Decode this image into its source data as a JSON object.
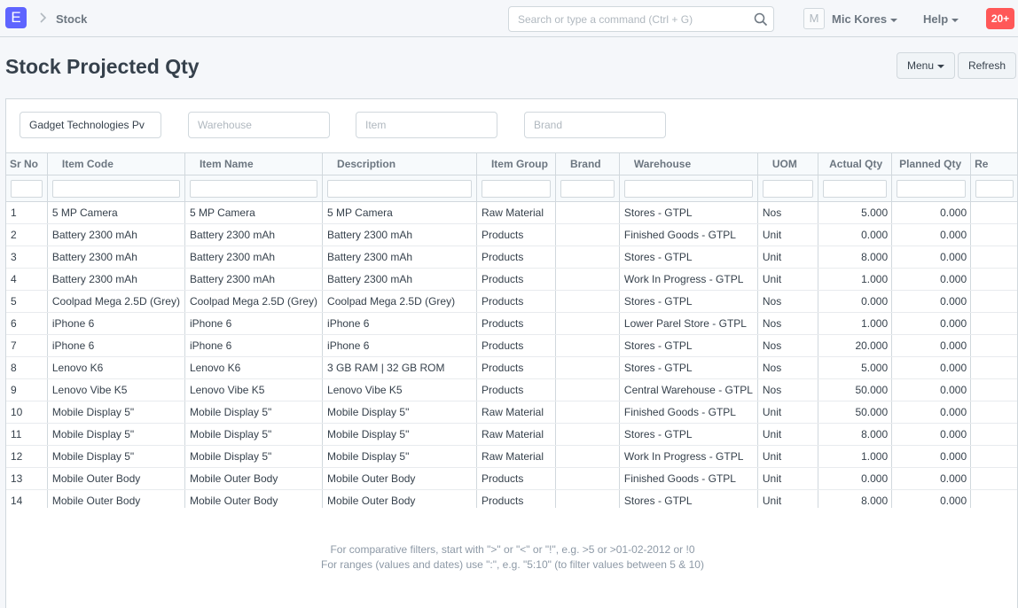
{
  "navbar": {
    "logo": "E",
    "breadcrumb": "Stock",
    "search_placeholder": "Search or type a command (Ctrl + G)",
    "avatar": "M",
    "user": "Mic Kores",
    "help": "Help",
    "notifications": "20+"
  },
  "page": {
    "title": "Stock Projected Qty",
    "menu_label": "Menu",
    "refresh_label": "Refresh"
  },
  "filters": {
    "company": "Gadget Technologies Pv",
    "warehouse": "Warehouse",
    "item": "Item",
    "brand": "Brand"
  },
  "columns": [
    "Sr No",
    "Item Code",
    "Item Name",
    "Description",
    "Item Group",
    "Brand",
    "Warehouse",
    "UOM",
    "Actual Qty",
    "Planned Qty",
    "Re"
  ],
  "rows": [
    [
      "1",
      "5 MP Camera",
      "5 MP Camera",
      "5 MP Camera",
      "Raw Material",
      "",
      "Stores - GTPL",
      "Nos",
      "5.000",
      "0.000"
    ],
    [
      "2",
      "Battery 2300 mAh",
      "Battery 2300 mAh",
      "Battery 2300 mAh",
      "Products",
      "",
      "Finished Goods - GTPL",
      "Unit",
      "0.000",
      "0.000"
    ],
    [
      "3",
      "Battery 2300 mAh",
      "Battery 2300 mAh",
      "Battery 2300 mAh",
      "Products",
      "",
      "Stores - GTPL",
      "Unit",
      "8.000",
      "0.000"
    ],
    [
      "4",
      "Battery 2300 mAh",
      "Battery 2300 mAh",
      "Battery 2300 mAh",
      "Products",
      "",
      "Work In Progress - GTPL",
      "Unit",
      "1.000",
      "0.000"
    ],
    [
      "5",
      "Coolpad Mega 2.5D (Grey)",
      "Coolpad Mega 2.5D (Grey)",
      "Coolpad Mega 2.5D (Grey)",
      "Products",
      "",
      "Stores - GTPL",
      "Nos",
      "0.000",
      "0.000"
    ],
    [
      "6",
      "iPhone 6",
      "iPhone 6",
      "iPhone 6",
      "Products",
      "",
      "Lower Parel Store - GTPL",
      "Nos",
      "1.000",
      "0.000"
    ],
    [
      "7",
      "iPhone 6",
      "iPhone 6",
      "iPhone 6",
      "Products",
      "",
      "Stores - GTPL",
      "Nos",
      "20.000",
      "0.000"
    ],
    [
      "8",
      "Lenovo K6",
      "Lenovo K6",
      "3 GB RAM | 32 GB ROM",
      "Products",
      "",
      "Stores - GTPL",
      "Nos",
      "5.000",
      "0.000"
    ],
    [
      "9",
      "Lenovo Vibe K5",
      "Lenovo Vibe K5",
      "Lenovo Vibe K5",
      "Products",
      "",
      "Central Warehouse - GTPL",
      "Nos",
      "50.000",
      "0.000"
    ],
    [
      "10",
      "Mobile Display 5\"",
      "Mobile Display 5\"",
      "Mobile Display 5\"",
      "Raw Material",
      "",
      "Finished Goods - GTPL",
      "Unit",
      "50.000",
      "0.000"
    ],
    [
      "11",
      "Mobile Display 5\"",
      "Mobile Display 5\"",
      "Mobile Display 5\"",
      "Raw Material",
      "",
      "Stores - GTPL",
      "Unit",
      "8.000",
      "0.000"
    ],
    [
      "12",
      "Mobile Display 5\"",
      "Mobile Display 5\"",
      "Mobile Display 5\"",
      "Raw Material",
      "",
      "Work In Progress - GTPL",
      "Unit",
      "1.000",
      "0.000"
    ],
    [
      "13",
      "Mobile Outer Body",
      "Mobile Outer Body",
      "Mobile Outer Body",
      "Products",
      "",
      "Finished Goods - GTPL",
      "Unit",
      "0.000",
      "0.000"
    ],
    [
      "14",
      "Mobile Outer Body",
      "Mobile Outer Body",
      "Mobile Outer Body",
      "Products",
      "",
      "Stores - GTPL",
      "Unit",
      "8.000",
      "0.000"
    ]
  ],
  "hints": [
    "For comparative filters, start with \">\" or \"<\" or \"!\", e.g. >5 or >01-02-2012 or !0",
    "For ranges (values and dates) use \":\", e.g. \"5:10\" (to filter values between 5 & 10)"
  ]
}
